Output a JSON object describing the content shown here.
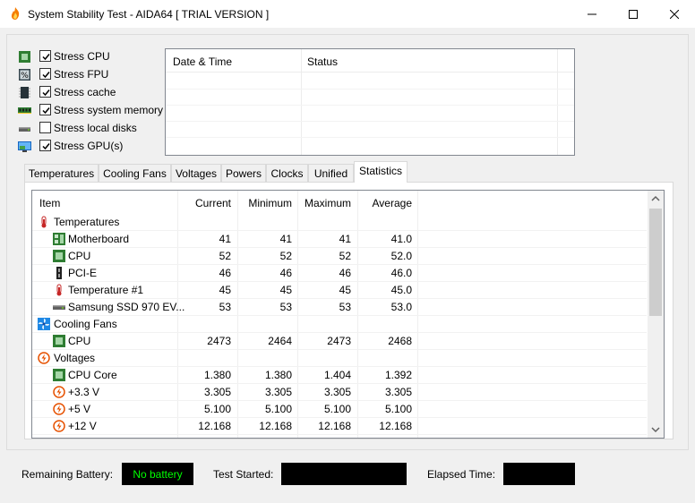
{
  "window": {
    "title": "System Stability Test - AIDA64  [ TRIAL VERSION ]",
    "minimize_glyph": "—",
    "maximize_glyph": "☐",
    "close_glyph": "✕"
  },
  "stress_options": [
    {
      "label": "Stress CPU",
      "checked": true,
      "icon": "cpu-chip-icon"
    },
    {
      "label": "Stress FPU",
      "checked": true,
      "icon": "fpu-percent-icon"
    },
    {
      "label": "Stress cache",
      "checked": true,
      "icon": "cache-chip-icon"
    },
    {
      "label": "Stress system memory",
      "checked": true,
      "icon": "memory-module-icon"
    },
    {
      "label": "Stress local disks",
      "checked": false,
      "icon": "disk-drive-icon"
    },
    {
      "label": "Stress GPU(s)",
      "checked": true,
      "icon": "gpu-monitor-icon"
    }
  ],
  "log": {
    "columns": [
      "Date & Time",
      "Status"
    ]
  },
  "tabs": [
    {
      "label": "Temperatures",
      "active": false
    },
    {
      "label": "Cooling Fans",
      "active": false
    },
    {
      "label": "Voltages",
      "active": false
    },
    {
      "label": "Powers",
      "active": false
    },
    {
      "label": "Clocks",
      "active": false
    },
    {
      "label": "Unified",
      "active": false
    },
    {
      "label": "Statistics",
      "active": true
    }
  ],
  "stats": {
    "columns": [
      "Item",
      "Current",
      "Minimum",
      "Maximum",
      "Average"
    ],
    "rows": [
      {
        "type": "group",
        "label": "Temperatures",
        "icon": "thermometer-icon"
      },
      {
        "type": "item",
        "label": "Motherboard",
        "icon": "motherboard-icon",
        "values": [
          "41",
          "41",
          "41",
          "41.0"
        ]
      },
      {
        "type": "item",
        "label": "CPU",
        "icon": "cpu-chip-icon",
        "values": [
          "52",
          "52",
          "52",
          "52.0"
        ]
      },
      {
        "type": "item",
        "label": "PCI-E",
        "icon": "pci-slot-icon",
        "values": [
          "46",
          "46",
          "46",
          "46.0"
        ]
      },
      {
        "type": "item",
        "label": "Temperature #1",
        "icon": "thermometer-icon",
        "values": [
          "45",
          "45",
          "45",
          "45.0"
        ]
      },
      {
        "type": "item",
        "label": "Samsung SSD 970 EV...",
        "icon": "disk-drive-icon",
        "values": [
          "53",
          "53",
          "53",
          "53.0"
        ]
      },
      {
        "type": "group",
        "label": "Cooling Fans",
        "icon": "fan-icon"
      },
      {
        "type": "item",
        "label": "CPU",
        "icon": "cpu-chip-icon",
        "values": [
          "2473",
          "2464",
          "2473",
          "2468"
        ]
      },
      {
        "type": "group",
        "label": "Voltages",
        "icon": "voltage-icon"
      },
      {
        "type": "item",
        "label": "CPU Core",
        "icon": "cpu-chip-icon",
        "values": [
          "1.380",
          "1.380",
          "1.404",
          "1.392"
        ]
      },
      {
        "type": "item",
        "label": "+3.3 V",
        "icon": "voltage-icon",
        "values": [
          "3.305",
          "3.305",
          "3.305",
          "3.305"
        ]
      },
      {
        "type": "item",
        "label": "+5 V",
        "icon": "voltage-icon",
        "values": [
          "5.100",
          "5.100",
          "5.100",
          "5.100"
        ]
      },
      {
        "type": "item",
        "label": "+12 V",
        "icon": "voltage-icon",
        "values": [
          "12.168",
          "12.168",
          "12.168",
          "12.168"
        ]
      }
    ]
  },
  "status_bar": {
    "battery_label": "Remaining Battery:",
    "battery_value": "No battery",
    "test_started_label": "Test Started:",
    "elapsed_label": "Elapsed Time:"
  },
  "colors": {
    "battery_text": "#00ff00",
    "icon_green": "#2e7d32",
    "fan_blue": "#1e88e5",
    "voltage_orange": "#e65100",
    "thermo_red": "#c62828"
  }
}
